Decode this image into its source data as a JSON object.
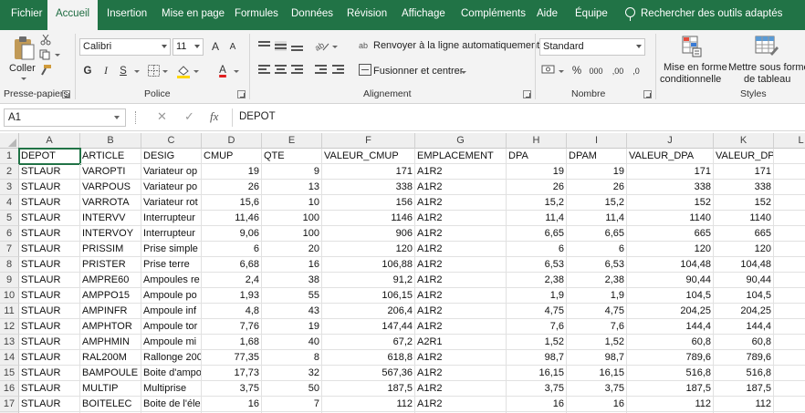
{
  "tabs": [
    {
      "label": "Fichier",
      "active": false
    },
    {
      "label": "Accueil",
      "active": true
    },
    {
      "label": "Insertion",
      "active": false
    },
    {
      "label": "Mise en page",
      "active": false
    },
    {
      "label": "Formules",
      "active": false
    },
    {
      "label": "Données",
      "active": false
    },
    {
      "label": "Révision",
      "active": false
    },
    {
      "label": "Affichage",
      "active": false
    },
    {
      "label": "Compléments",
      "active": false
    },
    {
      "label": "Aide",
      "active": false
    },
    {
      "label": "Équipe",
      "active": false
    }
  ],
  "search": {
    "label": "Rechercher des outils adaptés",
    "icon": "lightbulb-icon"
  },
  "ribbon": {
    "clipboard": {
      "group_label": "Presse-papiers",
      "paste_label": "Coller"
    },
    "font": {
      "group_label": "Police",
      "font_name": "Calibri",
      "font_size": "11",
      "bold": "G",
      "italic": "I",
      "underline": "S",
      "grow": "A",
      "shrink": "A",
      "font_color_letter": "A",
      "font_color": "#e01e1e",
      "fill_color": "#ffd700"
    },
    "alignment": {
      "group_label": "Alignement",
      "wrap_label": "Renvoyer à la ligne automatiquement",
      "merge_label": "Fusionner et centrer"
    },
    "number": {
      "group_label": "Nombre",
      "format": "Standard",
      "percent": "%",
      "thousands": "000",
      "inc_decimals": ",00",
      "dec_decimals": ",0"
    },
    "styles": {
      "group_label": "Styles",
      "cond_format_label_1": "Mise en forme",
      "cond_format_label_2": "conditionnelle",
      "table_format_label_1": "Mettre sous forme",
      "table_format_label_2": "de tableau"
    }
  },
  "formula_bar": {
    "name_box": "A1",
    "cancel": "✕",
    "enter": "✓",
    "fx": "fx",
    "value": "DEPOT"
  },
  "accent": "#217346",
  "columns": [
    "A",
    "B",
    "C",
    "D",
    "E",
    "F",
    "G",
    "H",
    "I",
    "J",
    "K",
    "L"
  ],
  "rows": [
    {
      "num": "1",
      "cells": [
        "DEPOT",
        "ARTICLE",
        "DESIG",
        "CMUP",
        "QTE",
        "VALEUR_CMUP",
        "EMPLACEMENT",
        "DPA",
        "DPAM",
        "VALEUR_DPA",
        "VALEUR_DPAM",
        ""
      ]
    },
    {
      "num": "2",
      "cells": [
        "STLAUR",
        "VAROPTI",
        "Variateur op",
        "19",
        "9",
        "171",
        "A1R2",
        "19",
        "19",
        "171",
        "171",
        ""
      ]
    },
    {
      "num": "3",
      "cells": [
        "STLAUR",
        "VARPOUS",
        "Variateur po",
        "26",
        "13",
        "338",
        "A1R2",
        "26",
        "26",
        "338",
        "338",
        ""
      ]
    },
    {
      "num": "4",
      "cells": [
        "STLAUR",
        "VARROTA",
        "Variateur rot",
        "15,6",
        "10",
        "156",
        "A1R2",
        "15,2",
        "15,2",
        "152",
        "152",
        ""
      ]
    },
    {
      "num": "5",
      "cells": [
        "STLAUR",
        "INTERVV",
        "Interrupteur",
        "11,46",
        "100",
        "1146",
        "A1R2",
        "11,4",
        "11,4",
        "1140",
        "1140",
        ""
      ]
    },
    {
      "num": "6",
      "cells": [
        "STLAUR",
        "INTERVOY",
        "Interrupteur",
        "9,06",
        "100",
        "906",
        "A1R2",
        "6,65",
        "6,65",
        "665",
        "665",
        ""
      ]
    },
    {
      "num": "7",
      "cells": [
        "STLAUR",
        "PRISSIM",
        "Prise simple",
        "6",
        "20",
        "120",
        "A1R2",
        "6",
        "6",
        "120",
        "120",
        ""
      ]
    },
    {
      "num": "8",
      "cells": [
        "STLAUR",
        "PRISTER",
        "Prise terre",
        "6,68",
        "16",
        "106,88",
        "A1R2",
        "6,53",
        "6,53",
        "104,48",
        "104,48",
        ""
      ]
    },
    {
      "num": "9",
      "cells": [
        "STLAUR",
        "AMPRE60",
        "Ampoules re",
        "2,4",
        "38",
        "91,2",
        "A1R2",
        "2,38",
        "2,38",
        "90,44",
        "90,44",
        ""
      ]
    },
    {
      "num": "10",
      "cells": [
        "STLAUR",
        "AMPPO15",
        "Ampoule po",
        "1,93",
        "55",
        "106,15",
        "A1R2",
        "1,9",
        "1,9",
        "104,5",
        "104,5",
        ""
      ]
    },
    {
      "num": "11",
      "cells": [
        "STLAUR",
        "AMPINFR",
        "Ampoule inf",
        "4,8",
        "43",
        "206,4",
        "A1R2",
        "4,75",
        "4,75",
        "204,25",
        "204,25",
        ""
      ]
    },
    {
      "num": "12",
      "cells": [
        "STLAUR",
        "AMPHTOR",
        "Ampoule tor",
        "7,76",
        "19",
        "147,44",
        "A1R2",
        "7,6",
        "7,6",
        "144,4",
        "144,4",
        ""
      ]
    },
    {
      "num": "13",
      "cells": [
        "STLAUR",
        "AMPHMIN",
        "Ampoule mi",
        "1,68",
        "40",
        "67,2",
        "A2R1",
        "1,52",
        "1,52",
        "60,8",
        "60,8",
        ""
      ]
    },
    {
      "num": "14",
      "cells": [
        "STLAUR",
        "RAL200M",
        "Rallonge 200",
        "77,35",
        "8",
        "618,8",
        "A1R2",
        "98,7",
        "98,7",
        "789,6",
        "789,6",
        ""
      ]
    },
    {
      "num": "15",
      "cells": [
        "STLAUR",
        "BAMPOULE",
        "Boite d'ampo",
        "17,73",
        "32",
        "567,36",
        "A1R2",
        "16,15",
        "16,15",
        "516,8",
        "516,8",
        ""
      ]
    },
    {
      "num": "16",
      "cells": [
        "STLAUR",
        "MULTIP",
        "Multiprise",
        "3,75",
        "50",
        "187,5",
        "A1R2",
        "3,75",
        "3,75",
        "187,5",
        "187,5",
        ""
      ]
    },
    {
      "num": "17",
      "cells": [
        "STLAUR",
        "BOITELEC",
        "Boite de l'éle",
        "16",
        "7",
        "112",
        "A1R2",
        "16",
        "16",
        "112",
        "112",
        ""
      ]
    },
    {
      "num": "18",
      "cells": [
        "",
        "",
        "",
        "",
        "",
        "",
        "",
        "",
        "",
        "",
        "",
        ""
      ]
    }
  ]
}
